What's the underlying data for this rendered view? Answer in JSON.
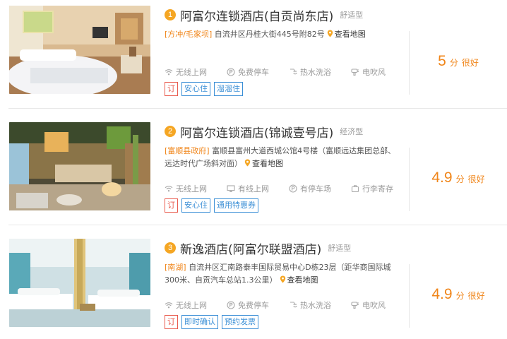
{
  "hotels": [
    {
      "rank": "1",
      "name": "阿富尔连锁酒店(自贡尚东店)",
      "level": "舒适型",
      "district": "[方冲/毛家坝]",
      "address": "自流井区丹桂大街445号附82号",
      "map_label": "查看地图",
      "amenities": [
        {
          "icon": "wifi-icon",
          "label": "无线上网"
        },
        {
          "icon": "parking-icon",
          "label": "免费停车"
        },
        {
          "icon": "shower-icon",
          "label": "热水洗浴"
        },
        {
          "icon": "hairdryer-icon",
          "label": "电吹风"
        }
      ],
      "tags": [
        {
          "label": "订",
          "color": "red"
        },
        {
          "label": "安心住",
          "color": "blue"
        },
        {
          "label": "溜溜住",
          "color": "blue"
        }
      ],
      "score": "5",
      "score_unit": "分",
      "rating": "很好"
    },
    {
      "rank": "2",
      "name": "阿富尔连锁酒店(锦诚壹号店)",
      "level": "经济型",
      "district": "[富顺县政府]",
      "address": "富顺县富州大道西城公馆4号楼（富顺远达集团总部、远达时代广场斜对面）",
      "map_label": "查看地图",
      "amenities": [
        {
          "icon": "wifi-icon",
          "label": "无线上网"
        },
        {
          "icon": "monitor-icon",
          "label": "有线上网"
        },
        {
          "icon": "parking-icon",
          "label": "有停车场"
        },
        {
          "icon": "luggage-icon",
          "label": "行李寄存"
        }
      ],
      "tags": [
        {
          "label": "订",
          "color": "red"
        },
        {
          "label": "安心住",
          "color": "blue"
        },
        {
          "label": "通用特惠券",
          "color": "blue"
        }
      ],
      "score": "4.9",
      "score_unit": "分",
      "rating": "很好"
    },
    {
      "rank": "3",
      "name": "新逸酒店(阿富尔联盟酒店)",
      "level": "舒适型",
      "district": "[南湖]",
      "address": "自流井区汇南路泰丰国际贸易中心D栋23层（距华商国际城300米、自贡汽车总站1.3公里）",
      "map_label": "查看地图",
      "amenities": [
        {
          "icon": "wifi-icon",
          "label": "无线上网"
        },
        {
          "icon": "parking-icon",
          "label": "免费停车"
        },
        {
          "icon": "shower-icon",
          "label": "热水洗浴"
        },
        {
          "icon": "hairdryer-icon",
          "label": "电吹风"
        }
      ],
      "tags": [
        {
          "label": "订",
          "color": "red"
        },
        {
          "label": "即时确认",
          "color": "blue"
        },
        {
          "label": "预约发票",
          "color": "blue"
        }
      ],
      "score": "4.9",
      "score_unit": "分",
      "rating": "很好"
    }
  ],
  "colors": {
    "accent_orange": "#f08519",
    "tag_red": "#e95b4e",
    "tag_blue": "#3b8fd6",
    "rank_badge": "#f5a623"
  }
}
